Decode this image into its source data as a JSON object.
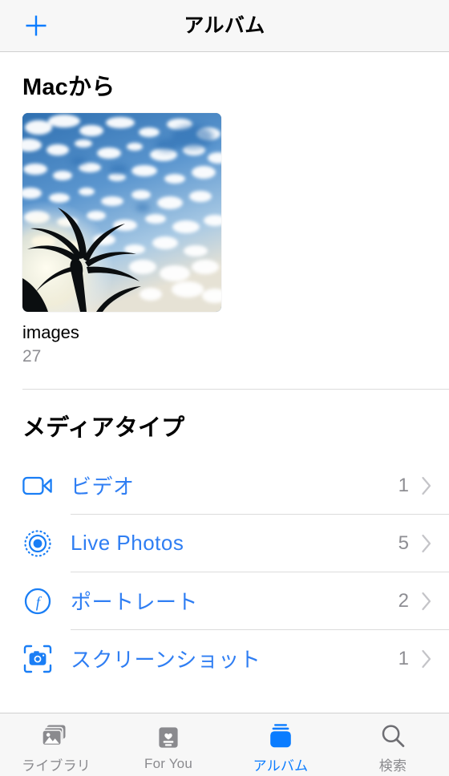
{
  "navbar": {
    "add_label": "+",
    "title": "アルバム"
  },
  "sections": {
    "mac": {
      "title": "Macから",
      "albums": [
        {
          "name": "images",
          "count": "27",
          "thumbnail": "sky-clouds-palm-tree-photo"
        }
      ]
    },
    "media_types": {
      "title": "メディアタイプ",
      "rows": [
        {
          "icon": "video-camera-icon",
          "label": "ビデオ",
          "count": "1",
          "chevron": "chevron-right-icon"
        },
        {
          "icon": "live-photos-icon",
          "label": "Live Photos",
          "count": "5",
          "chevron": "chevron-right-icon"
        },
        {
          "icon": "portrait-aperture-icon",
          "label": "ポートレート",
          "count": "2",
          "chevron": "chevron-right-icon"
        },
        {
          "icon": "screenshot-camera-icon",
          "label": "スクリーンショット",
          "count": "1",
          "chevron": "chevron-right-icon"
        }
      ]
    }
  },
  "tabbar": {
    "tabs": [
      {
        "icon": "photos-library-icon",
        "label": "ライブラリ",
        "active": false
      },
      {
        "icon": "for-you-heart-card-icon",
        "label": "For You",
        "active": false
      },
      {
        "icon": "albums-stack-icon",
        "label": "アルバム",
        "active": true
      },
      {
        "icon": "search-magnifier-icon",
        "label": "検索",
        "active": false
      }
    ]
  },
  "colors": {
    "accent_blue": "#0a7cff",
    "link_blue": "#2f7ef3",
    "secondary_gray": "#8e8e93",
    "bar_background": "#f7f7f7",
    "separator": "#dcdcdc"
  }
}
